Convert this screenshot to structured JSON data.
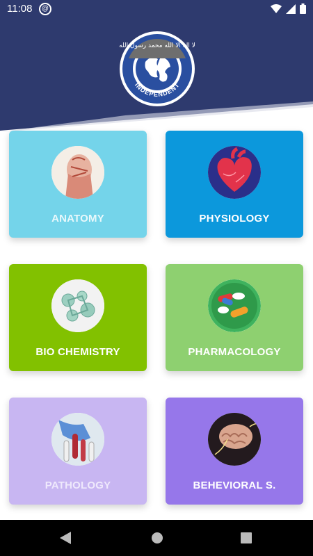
{
  "status_bar": {
    "time": "11:08"
  },
  "header": {
    "logo_text": "INDEPENDENT",
    "logo_arabic": "لا اله الا الله محمد رسول الله"
  },
  "cards": [
    {
      "label": "ANATOMY",
      "bg": "#74d4ea",
      "label_color": "#e8f8fb"
    },
    {
      "label": "PHYSIOLOGY",
      "bg": "#0c98dc",
      "label_color": "#ffffff"
    },
    {
      "label": "BIO CHEMISTRY",
      "bg": "#82c100",
      "label_color": "#ffffff"
    },
    {
      "label": "PHARMACOLOGY",
      "bg": "#8ed070",
      "label_color": "#ffffff"
    },
    {
      "label": "PATHOLOGY",
      "bg": "#c8b6f2",
      "label_color": "#efe9fc"
    },
    {
      "label": "BEHEVIORAL S.",
      "bg": "#9677ea",
      "label_color": "#ffffff"
    }
  ],
  "colors": {
    "header": "#2e3a6e",
    "nav": "#000000"
  }
}
